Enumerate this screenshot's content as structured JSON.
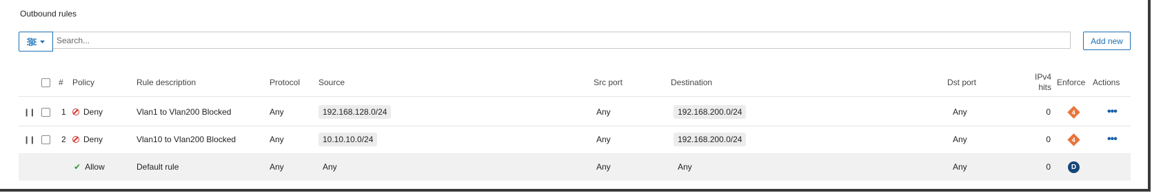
{
  "section_title": "Outbound rules",
  "search": {
    "placeholder": "Search..."
  },
  "toolbar": {
    "add_new_label": "Add new"
  },
  "columns": {
    "num": "#",
    "policy": "Policy",
    "description": "Rule description",
    "protocol": "Protocol",
    "source": "Source",
    "src_port": "Src port",
    "destination": "Destination",
    "dst_port": "Dst port",
    "hits_line1": "IPv4",
    "hits_line2": "hits",
    "enforce": "Enforce",
    "actions": "Actions"
  },
  "rules": [
    {
      "num": "1",
      "policy": "Deny",
      "description": "Vlan1 to Vlan200 Blocked",
      "protocol": "Any",
      "source": "192.168.128.0/24",
      "src_port": "Any",
      "destination": "192.168.200.0/24",
      "dst_port": "Any",
      "hits": "0",
      "enforce": "4"
    },
    {
      "num": "2",
      "policy": "Deny",
      "description": "Vlan10 to Vlan200 Blocked",
      "protocol": "Any",
      "source": "10.10.10.0/24",
      "src_port": "Any",
      "destination": "192.168.200.0/24",
      "dst_port": "Any",
      "hits": "0",
      "enforce": "4"
    }
  ],
  "default_rule": {
    "policy": "Allow",
    "description": "Default rule",
    "protocol": "Any",
    "source": "Any",
    "src_port": "Any",
    "destination": "Any",
    "dst_port": "Any",
    "hits": "0",
    "enforce": "D"
  },
  "colors": {
    "accent": "#1a6fb5",
    "deny": "#d0302c",
    "allow": "#2e9a3a",
    "enforce_rule": "#e8733a",
    "enforce_default": "#16457a"
  },
  "icons": {
    "filter": "sliders-icon",
    "drag": "drag-handle-icon",
    "deny": "no-entry-icon",
    "allow": "checkmark-icon",
    "actions": "more-horizontal-icon"
  }
}
